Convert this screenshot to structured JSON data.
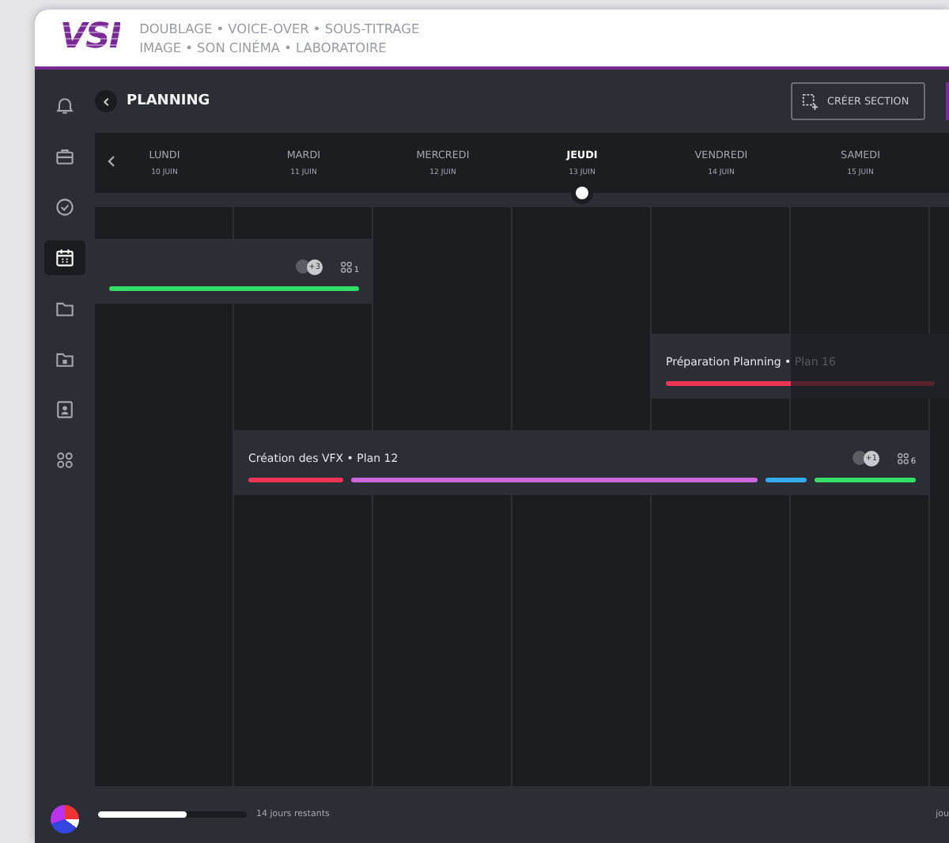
{
  "header": {
    "logo": "VSI",
    "tagline": [
      "DOUBLAGE • VOICE-OVER • SOUS-TITRAGE",
      "IMAGE • SON CINÉMA • LABORATOIRE"
    ]
  },
  "sidebar": {
    "items": [
      {
        "kind": "bell",
        "selected": false
      },
      {
        "kind": "briefcase",
        "selected": false
      },
      {
        "kind": "check",
        "selected": false
      },
      {
        "kind": "calendar",
        "selected": true
      },
      {
        "kind": "folder",
        "selected": false
      },
      {
        "kind": "folder-calendar",
        "selected": false
      },
      {
        "kind": "contact",
        "selected": false
      },
      {
        "kind": "apps",
        "selected": false
      }
    ]
  },
  "toolbar": {
    "title": "PLANNING",
    "button": "CRÉER SECTION"
  },
  "days": [
    {
      "name": "LUNDI",
      "date": "10 JUIN",
      "selected": false
    },
    {
      "name": "MARDI",
      "date": "11 JUIN",
      "selected": false
    },
    {
      "name": "MERCREDI",
      "date": "12 JUIN",
      "selected": false
    },
    {
      "name": "JEUDI",
      "date": "13 JUIN",
      "selected": true
    },
    {
      "name": "VENDREDI",
      "date": "14 JUIN",
      "selected": false
    },
    {
      "name": "SAMEDI",
      "date": "15 JUIN",
      "selected": false
    }
  ],
  "events": [
    {
      "people_count": "+3",
      "task_count": "1",
      "faded_tail": false,
      "bars": [
        {
          "color": "#33dd66"
        }
      ]
    },
    {
      "title": "Préparation Planning • Plan 16",
      "faded_tail": true,
      "bars": [
        {
          "color": "#ee3355"
        }
      ]
    },
    {
      "title": "Création des VFX • Plan 12",
      "people_count": "+1",
      "task_count": "6",
      "faded_tail": false,
      "bars": [
        {
          "color": "#ee3355"
        },
        {
          "color": "#cc66dd"
        },
        {
          "color": "#33aaee"
        },
        {
          "color": "#33dd66"
        }
      ]
    }
  ],
  "footer": {
    "level": 0.6,
    "remaining": "14 jours restants",
    "right_text": "jou"
  }
}
